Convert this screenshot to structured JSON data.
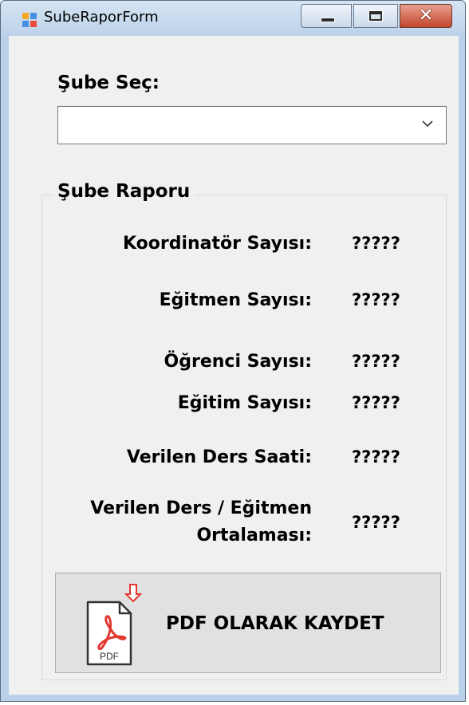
{
  "window": {
    "title": "SubeRaporForm",
    "close_glyph": "✕"
  },
  "form": {
    "select_label": "Şube Seç:",
    "select_value": "",
    "group_title": "Şube Raporu",
    "rows": [
      {
        "label": "Koordinatör Sayısı:",
        "value": "?????"
      },
      {
        "label": "Eğitmen Sayısı:",
        "value": "?????"
      },
      {
        "label": "Öğrenci Sayısı:",
        "value": "?????"
      },
      {
        "label": "Eğitim Sayısı:",
        "value": "?????"
      },
      {
        "label": "Verilen Ders Saati:",
        "value": "?????"
      },
      {
        "label_line1": "Verilen Ders / Eğitmen",
        "label_line2": "Ortalaması:",
        "value": "?????"
      }
    ],
    "pdf_button_label": "PDF OLARAK KAYDET",
    "pdf_icon_text": "PDF"
  },
  "colors": {
    "pdf_red": "#e2382f",
    "window_frame": "#b9d1ea",
    "client_bg": "#f0f0f0"
  }
}
